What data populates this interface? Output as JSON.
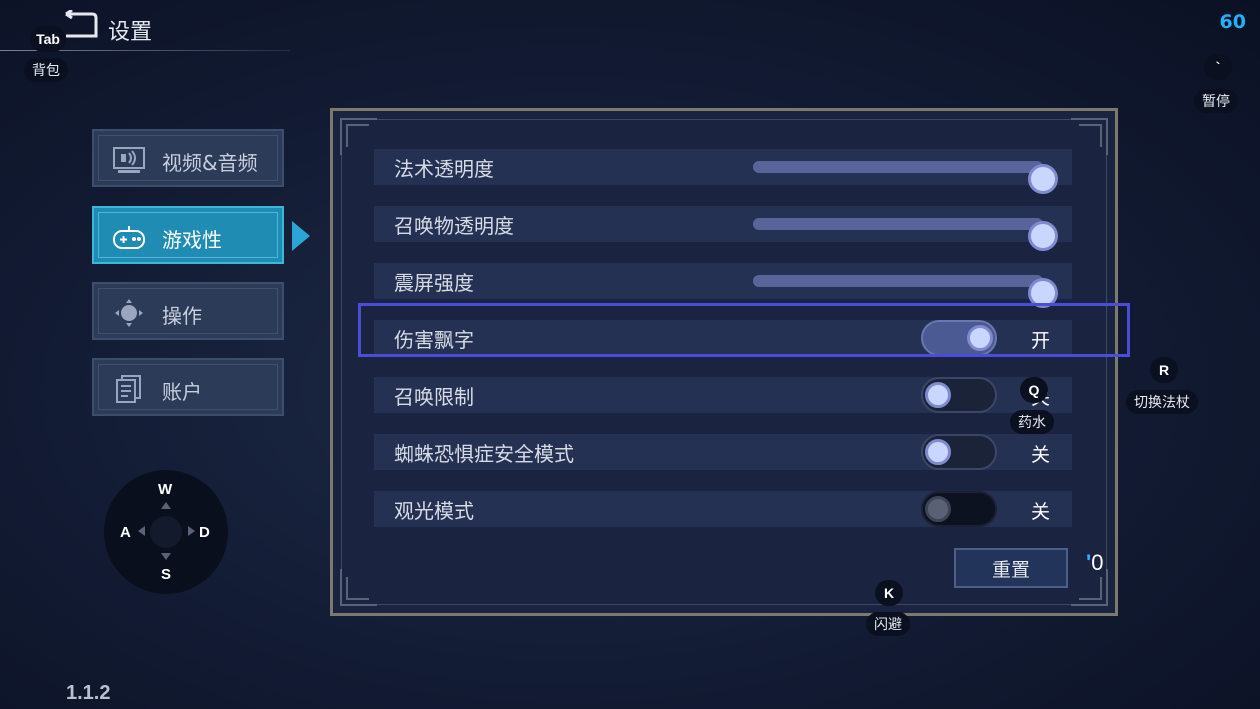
{
  "header": {
    "title": "设置",
    "fps": "60",
    "back_key": "Tab",
    "back_hint": "背包",
    "pause_key": "`",
    "pause_hint": "暂停"
  },
  "menu": {
    "items": [
      {
        "label": "视频&音频",
        "icon": "monitor-audio-icon",
        "active": false
      },
      {
        "label": "游戏性",
        "icon": "gamepad-icon",
        "active": true
      },
      {
        "label": "操作",
        "icon": "dpad-icon",
        "active": false
      },
      {
        "label": "账户",
        "icon": "documents-icon",
        "active": false
      }
    ]
  },
  "dpad": {
    "up": "W",
    "left": "A",
    "right": "D",
    "down": "S"
  },
  "version": "1.1.2",
  "settings": {
    "sliders": [
      {
        "label": "法术透明度",
        "value": 1.0
      },
      {
        "label": "召唤物透明度",
        "value": 1.0
      },
      {
        "label": "震屏强度",
        "value": 1.0
      }
    ],
    "toggles": [
      {
        "label": "伤害飘字",
        "on": true,
        "state": "开",
        "disabled": false
      },
      {
        "label": "召唤限制",
        "on": false,
        "state": "关",
        "disabled": false
      },
      {
        "label": "蜘蛛恐惧症安全模式",
        "on": false,
        "state": "关",
        "disabled": false
      },
      {
        "label": "观光模式",
        "on": false,
        "state": "关",
        "disabled": true
      }
    ],
    "reset_label": "重置",
    "reset_key": "0",
    "reset_key_prefix": "'"
  },
  "hints": {
    "potion_key": "Q",
    "potion_label": "药水",
    "switch_key": "R",
    "switch_label": "切换法杖",
    "dodge_key": "K",
    "dodge_label": "闪避"
  },
  "colors": {
    "accent": "#1fb2ff",
    "active_menu": "#1f8db3",
    "highlight": "#4c4dd6",
    "knob": "#c9d6ff"
  }
}
